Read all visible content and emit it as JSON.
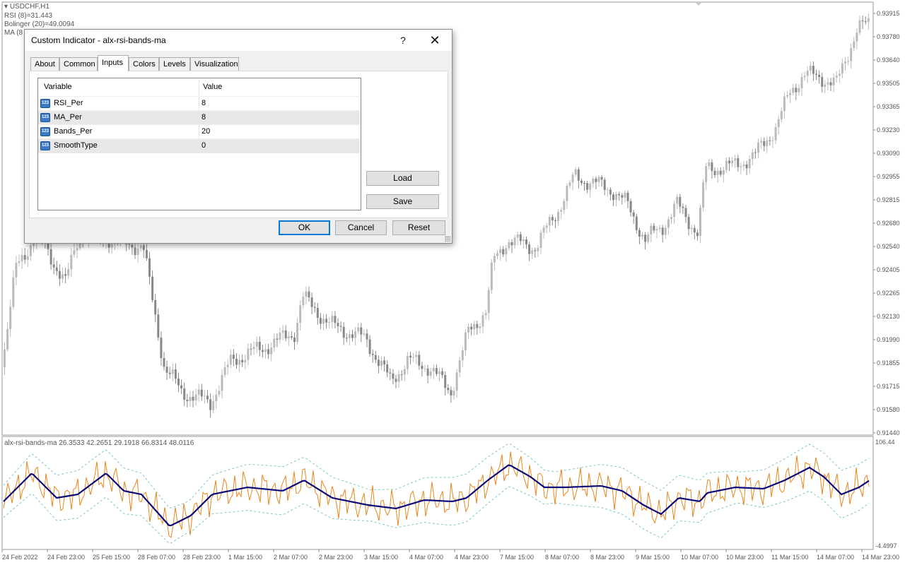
{
  "chart": {
    "symbol_timeframe": "USDCHF,H1",
    "rsi_label": "RSI (8)=31.443",
    "bollinger_label": "Bolinger (20)=49.0094",
    "ma_label_partial": "MA (8",
    "price_axis": [
      "0.93915",
      "0.93780",
      "0.93640",
      "0.93505",
      "0.93365",
      "0.93230",
      "0.93090",
      "0.92955",
      "0.92815",
      "0.92680",
      "0.92540",
      "0.92405",
      "0.92265",
      "0.92130",
      "0.91990",
      "0.91855",
      "0.91715",
      "0.91580",
      "0.91440"
    ],
    "indicator_axis_top": "106.44",
    "indicator_axis_bottom": "-4.4997",
    "time_axis": [
      "24 Feb 2022",
      "24 Feb 23:00",
      "25 Feb 15:00",
      "28 Feb 07:00",
      "28 Feb 23:00",
      "1 Mar 15:00",
      "2 Mar 07:00",
      "2 Mar 23:00",
      "3 Mar 15:00",
      "4 Mar 07:00",
      "4 Mar 23:00",
      "7 Mar 15:00",
      "8 Mar 07:00",
      "8 Mar 23:00",
      "9 Mar 15:00",
      "10 Mar 07:00",
      "10 Mar 23:00",
      "11 Mar 15:00",
      "14 Mar 07:00",
      "14 Mar 23:00"
    ],
    "colors": {
      "candle": "#999999",
      "rsi": "#e8871e",
      "ma": "#0a0a7a",
      "bands": "#7cc9c0"
    }
  },
  "indicator": {
    "label": "alx-rsi-bands-ma 26.3533 42.2651 29.1918 66.8314 48.0116"
  },
  "dialog": {
    "title": "Custom Indicator - alx-rsi-bands-ma",
    "help": "?",
    "close": "✕",
    "tabs": [
      "About",
      "Common",
      "Inputs",
      "Colors",
      "Levels",
      "Visualization"
    ],
    "active_tab": "Inputs",
    "columns": {
      "variable": "Variable",
      "value": "Value"
    },
    "type_icon": "123",
    "params": [
      {
        "name": "RSI_Per",
        "value": "8"
      },
      {
        "name": "MA_Per",
        "value": "8"
      },
      {
        "name": "Bands_Per",
        "value": "20"
      },
      {
        "name": "SmoothType",
        "value": "0"
      }
    ],
    "buttons": {
      "load": "Load",
      "save": "Save",
      "ok": "OK",
      "cancel": "Cancel",
      "reset": "Reset"
    }
  }
}
